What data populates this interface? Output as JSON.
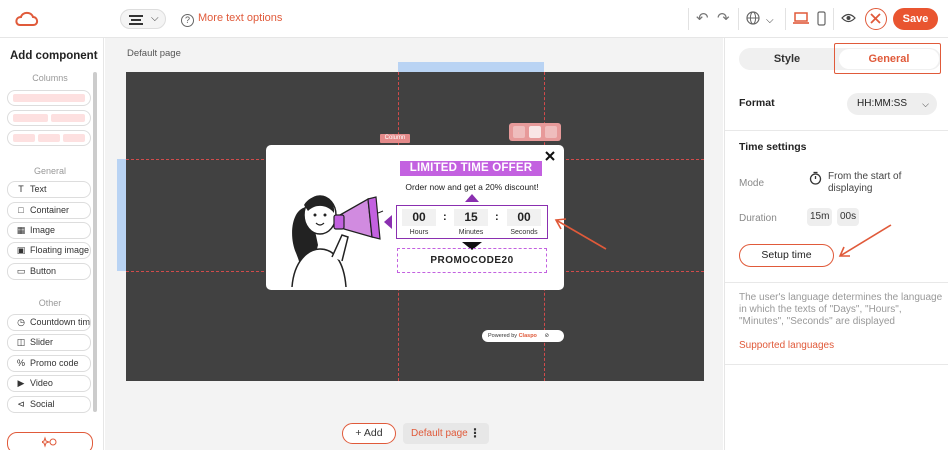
{
  "topbar": {
    "help_text": "More text options",
    "save_label": "Save"
  },
  "left": {
    "title": "Add component",
    "columns_label": "Columns",
    "general_label": "General",
    "general_items": [
      {
        "label": "Text",
        "icon": "text-icon"
      },
      {
        "label": "Container",
        "icon": "container-icon"
      },
      {
        "label": "Image",
        "icon": "image-icon"
      },
      {
        "label": "Floating image",
        "icon": "floating-image-icon"
      },
      {
        "label": "Button",
        "icon": "button-icon"
      }
    ],
    "other_label": "Other",
    "other_items": [
      {
        "label": "Countdown timer",
        "icon": "timer-icon"
      },
      {
        "label": "Slider",
        "icon": "slider-icon"
      },
      {
        "label": "Promo code",
        "icon": "percent-icon"
      },
      {
        "label": "Video",
        "icon": "play-icon"
      },
      {
        "label": "Social",
        "icon": "share-icon"
      }
    ]
  },
  "canvas": {
    "page_name": "Default page",
    "column_tag": "Column",
    "popup": {
      "title": "LIMITED TIME OFFER",
      "subtitle": "Order now and get a 20% discount!",
      "timer": {
        "hours": "00",
        "minutes": "15",
        "seconds": "00",
        "hours_label": "Hours",
        "minutes_label": "Minutes",
        "seconds_label": "Seconds"
      },
      "promo": "PROMOCODE20"
    },
    "powered_by": "Powered by",
    "powered_brand": "Claspo",
    "add_label": "Add",
    "page_selector": "Default page"
  },
  "right": {
    "tab_style": "Style",
    "tab_general": "General",
    "format_label": "Format",
    "format_value": "HH:MM:SS",
    "time_settings_label": "Time settings",
    "mode_label": "Mode",
    "mode_value": "From the start of displaying",
    "duration_label": "Duration",
    "duration_minutes": "15m",
    "duration_seconds": "00s",
    "setup_label": "Setup time",
    "info_text": "The user's language determines the language in which the texts of \"Days\", \"Hours\", \"Minutes\", \"Seconds\" are displayed",
    "info_link": "Supported languages"
  },
  "colors": {
    "accent": "#e95530",
    "purple": "#c361e0",
    "stage": "#414141"
  }
}
